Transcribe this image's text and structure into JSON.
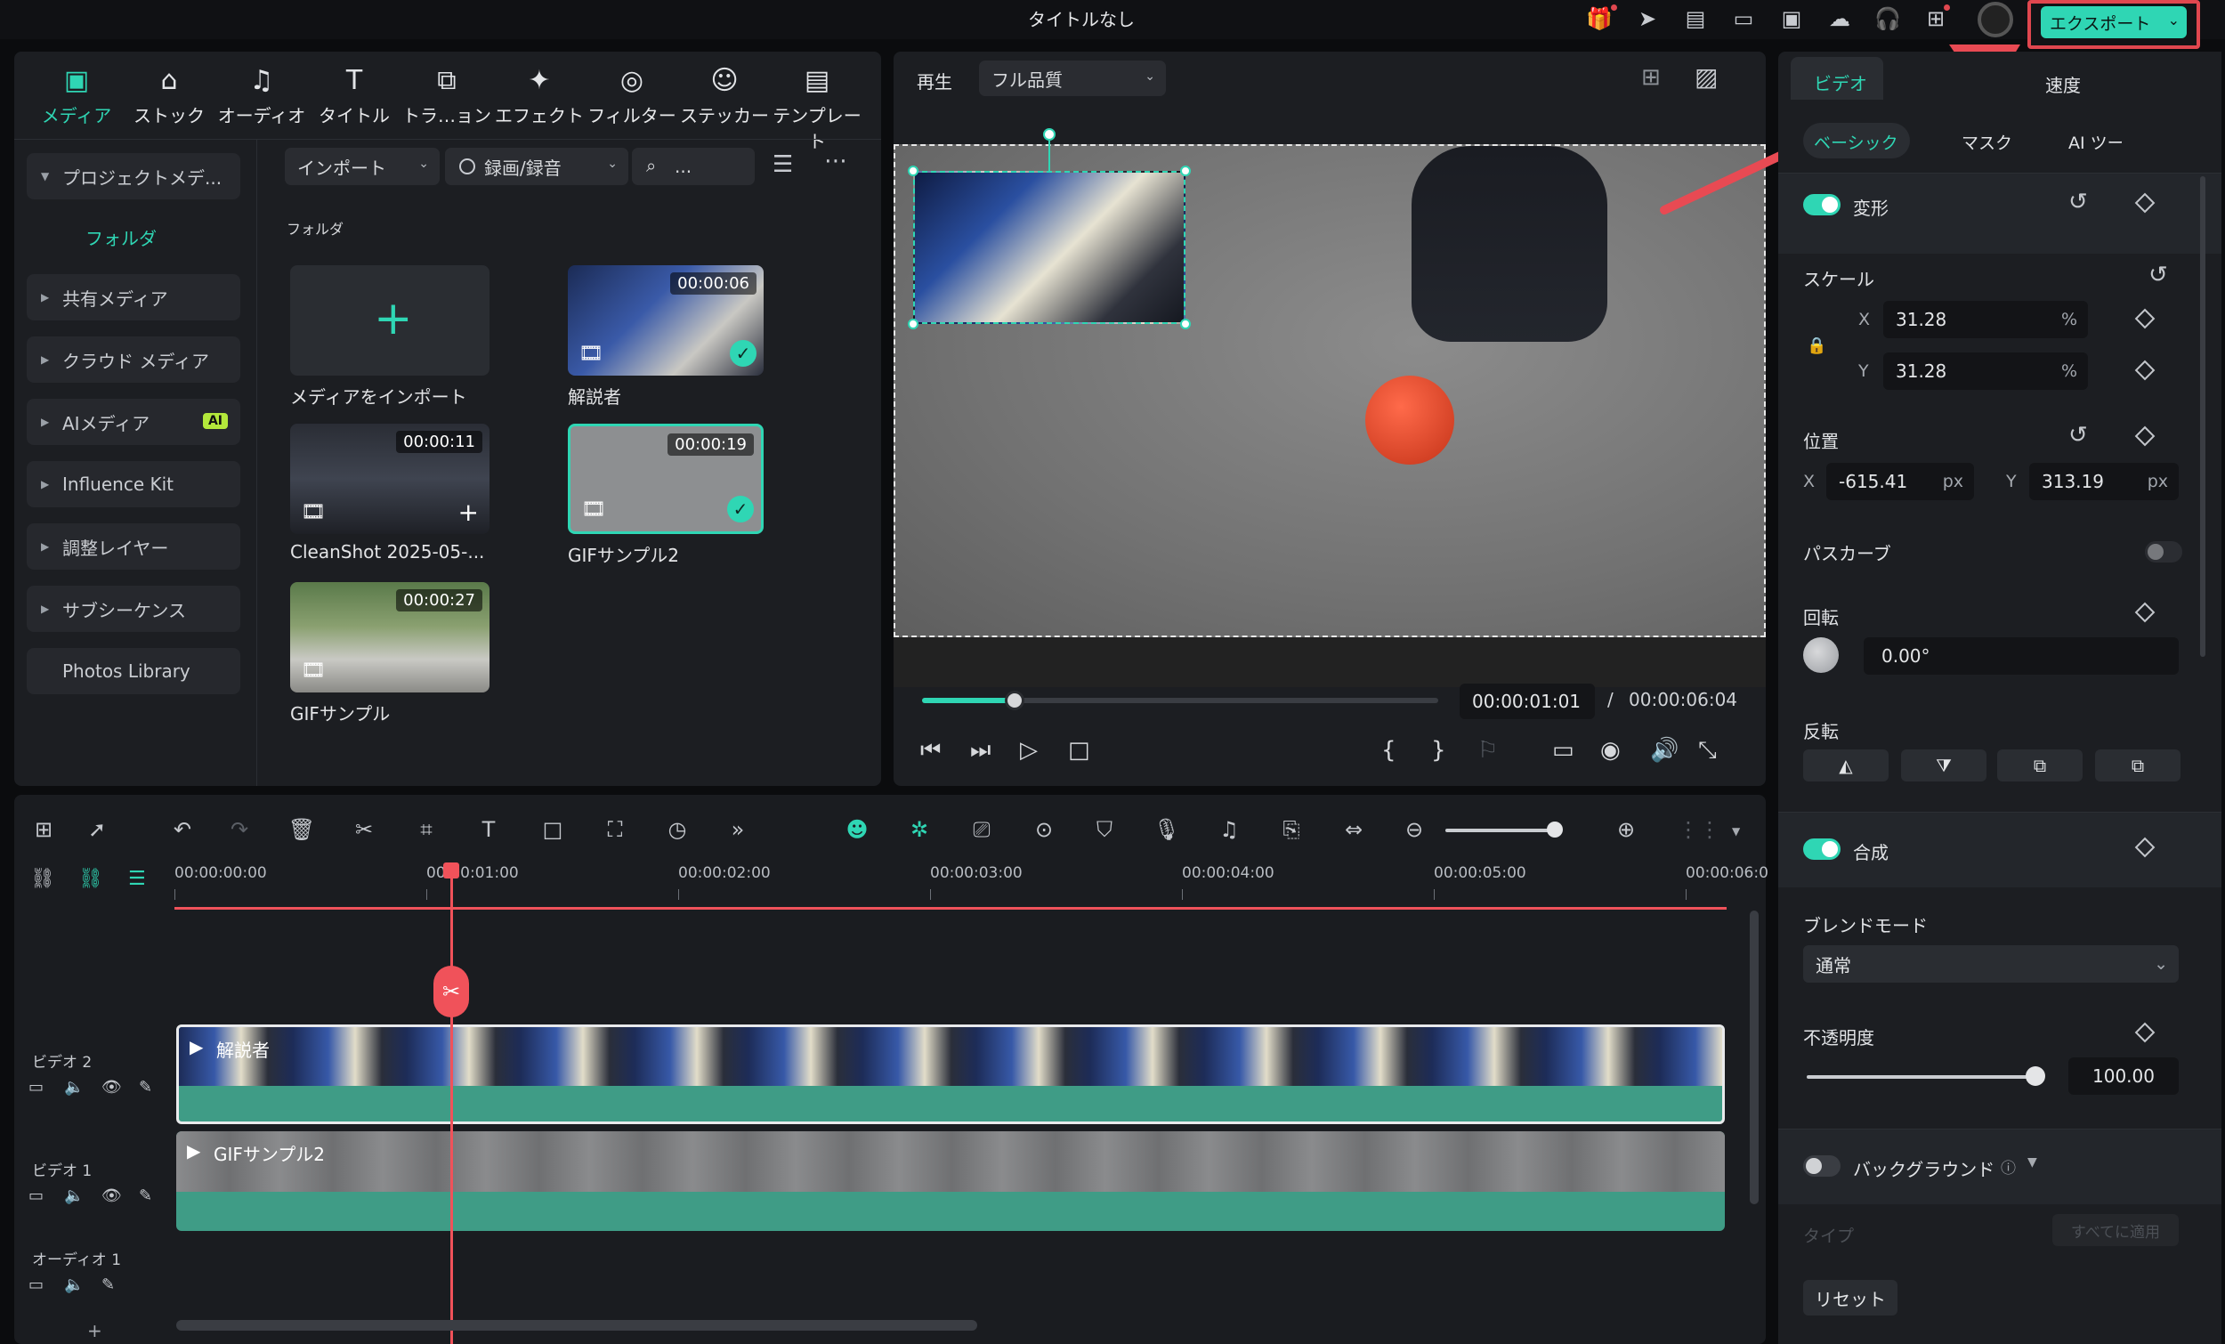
{
  "window": {
    "title": "タイトルなし"
  },
  "topbar": {
    "icons": [
      "gift-icon",
      "send-icon",
      "subtitle-icon",
      "layout-icon",
      "save-icon",
      "cloud-icon",
      "headset-icon",
      "apps-icon",
      "avatar"
    ],
    "export_label": "エクスポート"
  },
  "media_tabs": [
    {
      "label": "メディア",
      "icon": "media-icon"
    },
    {
      "label": "ストック",
      "icon": "stock-icon"
    },
    {
      "label": "オーディオ",
      "icon": "audio-icon"
    },
    {
      "label": "タイトル",
      "icon": "title-icon"
    },
    {
      "label": "トラ…ョン",
      "icon": "transition-icon"
    },
    {
      "label": "エフェクト",
      "icon": "effect-icon"
    },
    {
      "label": "フィルター",
      "icon": "filter-icon"
    },
    {
      "label": "ステッカー",
      "icon": "sticker-icon"
    },
    {
      "label": "テンプレート",
      "icon": "template-icon"
    }
  ],
  "sidebar": {
    "items": [
      {
        "label": "プロジェクトメデ..."
      },
      {
        "label": "フォルダ"
      },
      {
        "label": "共有メディア"
      },
      {
        "label": "クラウド メディア"
      },
      {
        "label": "AIメディア",
        "badge": "AI"
      },
      {
        "label": "Influence Kit"
      },
      {
        "label": "調整レイヤー"
      },
      {
        "label": "サブシーケンス"
      },
      {
        "label": "Photos Library"
      }
    ]
  },
  "media_toolbar": {
    "import_label": "インポート",
    "record_label": "録画/録音",
    "search_placeholder": "..."
  },
  "media_grid": {
    "folder_label": "フォルダ",
    "import_tile_label": "メディアをインポート",
    "items": [
      {
        "name": "解説者",
        "duration": "00:00:06"
      },
      {
        "name": "CleanShot 2025-05-...",
        "duration": "00:00:11"
      },
      {
        "name": "GIFサンプル2",
        "duration": "00:00:19"
      },
      {
        "name": "GIFサンプル",
        "duration": "00:00:27"
      }
    ]
  },
  "preview": {
    "play_label": "再生",
    "quality_label": "フル品質",
    "current_time": "00:00:01:01",
    "separator": "/",
    "total_time": "00:00:06:04",
    "progress": 0.18
  },
  "properties": {
    "tabs": {
      "video": "ビデオ",
      "speed": "速度"
    },
    "subtabs": {
      "basic": "ベーシック",
      "mask": "マスク",
      "ai": "AI ツー"
    },
    "transform_label": "変形",
    "scale_label": "スケール",
    "scale_x_label": "X",
    "scale_x": "31.28",
    "scale_y_label": "Y",
    "scale_y": "31.28",
    "percent": "%",
    "position_label": "位置",
    "pos_x_label": "X",
    "pos_x": "-615.41",
    "pos_y_label": "Y",
    "pos_y": "313.19",
    "px": "px",
    "path_curve_label": "パスカーブ",
    "rotation_label": "回転",
    "rotation_value": "0.00°",
    "flip_label": "反転",
    "composite_label": "合成",
    "blend_label": "ブレンドモード",
    "blend_value": "通常",
    "opacity_label": "不透明度",
    "opacity_value": "100.00",
    "background_label": "バックグラウンド",
    "type_label": "タイプ",
    "apply_all_label": "すべてに適用",
    "reset_label": "リセット"
  },
  "timeline": {
    "ruler": [
      "00:00:00:00",
      "00:00:01:00",
      "00:00:02:00",
      "00:00:03:00",
      "00:00:04:00",
      "00:00:05:00",
      "00:00:06:0"
    ],
    "tracks": [
      {
        "label": "ビデオ 2",
        "clip": "解説者"
      },
      {
        "label": "ビデオ 1",
        "clip": "GIFサンプル2"
      },
      {
        "label": "オーディオ 1",
        "clip": ""
      }
    ],
    "add_track": "+"
  },
  "colors": {
    "accent": "#2fd6b4",
    "export_border": "#e0474f",
    "playhead": "#f0525a",
    "clip_green": "#3f9c86"
  }
}
